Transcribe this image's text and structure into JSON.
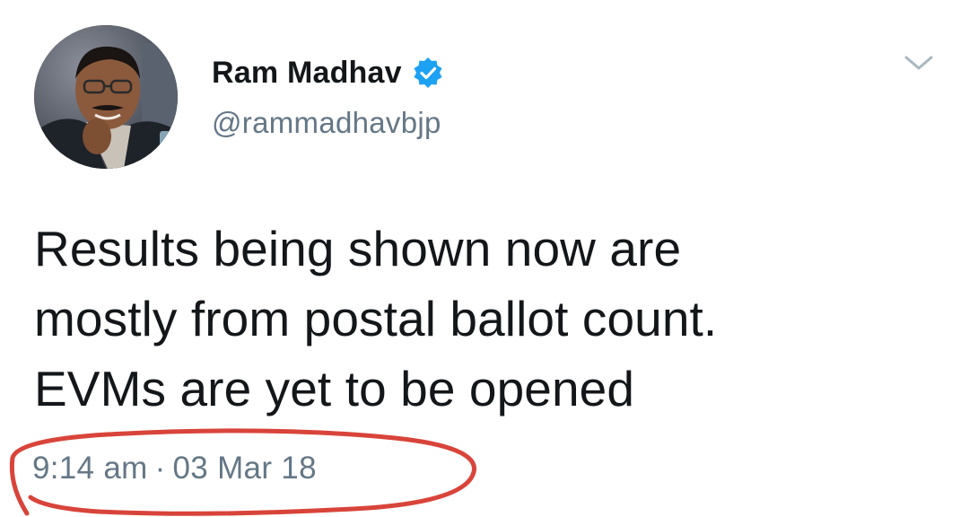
{
  "author": {
    "display_name": "Ram Madhav",
    "handle": "@rammadhavbjp",
    "verified": true
  },
  "tweet": {
    "text": "Results being shown now are\nmostly from postal ballot count.\nEVMs are yet to be opened",
    "time": "9:14 am",
    "separator": "·",
    "date": "03 Mar 18"
  },
  "icons": {
    "verified": "verified-badge-icon",
    "menu": "chevron-down-icon"
  },
  "colors": {
    "verified_blue": "#1da1f2",
    "secondary_text": "#657786",
    "annotation_red": "#d9443a"
  }
}
